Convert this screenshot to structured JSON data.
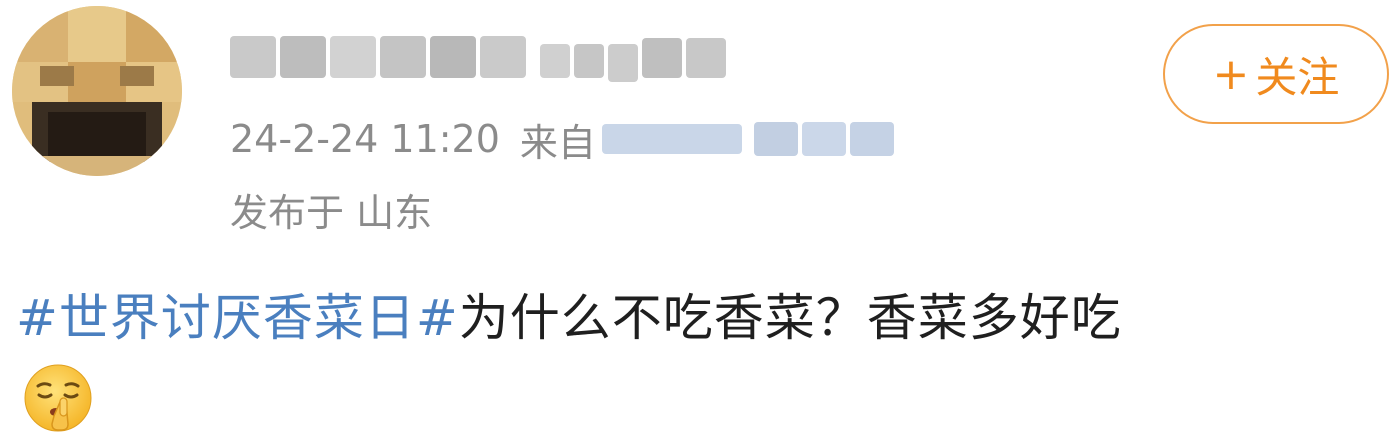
{
  "post": {
    "timestamp": "24-2-24 11:20",
    "source_prefix": "来自",
    "location": "发布于 山东",
    "follow_label": "关注",
    "follow_icon": "plus-icon",
    "topic": "#世界讨厌香菜日#",
    "body_text": "为什么不吃香菜？香菜多好吃",
    "emoji": "shush-emoji"
  },
  "colors": {
    "topic_link": "#4a7fbf",
    "follow_accent": "#f08a1e",
    "meta_text": "#8b8b8b",
    "body_text": "#1f1f1f"
  }
}
